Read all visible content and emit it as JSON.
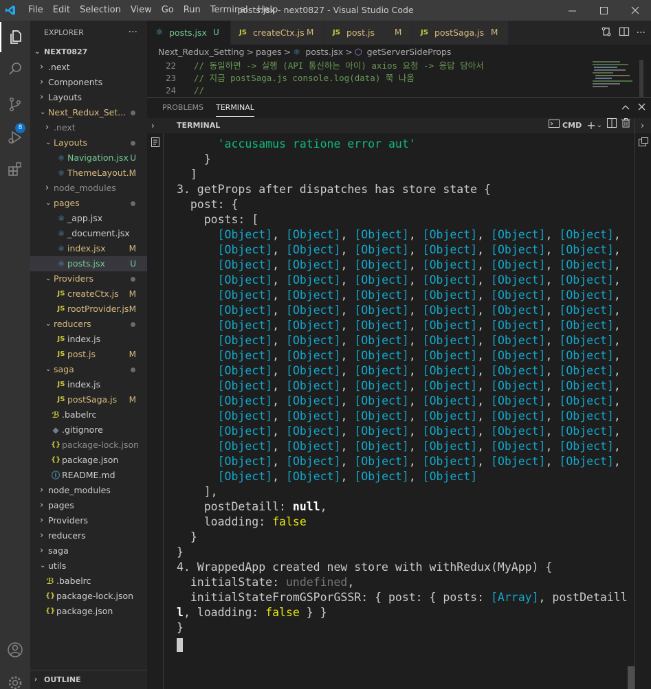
{
  "titlebar": {
    "menu": [
      "File",
      "Edit",
      "Selection",
      "View",
      "Go",
      "Run",
      "Terminal",
      "Help"
    ],
    "title": "posts.jsx - next0827 - Visual Studio Code"
  },
  "activity": {
    "scm_badge": "8"
  },
  "explorer": {
    "title": "EXPLORER",
    "more": "···",
    "root": "NEXT0827",
    "items": [
      {
        "label": ".next",
        "indent": 1,
        "kind": "folder",
        "open": false
      },
      {
        "label": "Components",
        "indent": 1,
        "kind": "folder",
        "open": false
      },
      {
        "label": "Layouts",
        "indent": 1,
        "kind": "folder",
        "open": false
      },
      {
        "label": "Next_Redux_Set...",
        "indent": 1,
        "kind": "folder",
        "open": true,
        "color": "#d7ba7d",
        "dot": true
      },
      {
        "label": ".next",
        "indent": 2,
        "kind": "folder",
        "open": false,
        "color": "#8c8c8c"
      },
      {
        "label": "Layouts",
        "indent": 2,
        "kind": "folder",
        "open": true,
        "color": "#d7ba7d",
        "dot": true
      },
      {
        "label": "Navigation.jsx",
        "indent": 3,
        "kind": "react",
        "color": "#73c991",
        "status": "U",
        "status_color": "#73c991"
      },
      {
        "label": "ThemeLayout...",
        "indent": 3,
        "kind": "react",
        "color": "#d7ba7d",
        "status": "M",
        "status_color": "#d7ba7d"
      },
      {
        "label": "node_modules",
        "indent": 2,
        "kind": "folder",
        "open": false,
        "color": "#8c8c8c"
      },
      {
        "label": "pages",
        "indent": 2,
        "kind": "folder",
        "open": true,
        "color": "#d7ba7d",
        "dot": true
      },
      {
        "label": "_app.jsx",
        "indent": 3,
        "kind": "react"
      },
      {
        "label": "_document.jsx",
        "indent": 3,
        "kind": "react"
      },
      {
        "label": "index.jsx",
        "indent": 3,
        "kind": "react",
        "color": "#d7ba7d",
        "status": "M",
        "status_color": "#d7ba7d"
      },
      {
        "label": "posts.jsx",
        "indent": 3,
        "kind": "react",
        "color": "#73c991",
        "status": "U",
        "status_color": "#73c991",
        "selected": true
      },
      {
        "label": "Providers",
        "indent": 2,
        "kind": "folder",
        "open": true,
        "color": "#d7ba7d",
        "dot": true
      },
      {
        "label": "createCtx.js",
        "indent": 3,
        "kind": "js",
        "color": "#d7ba7d",
        "status": "M",
        "status_color": "#d7ba7d"
      },
      {
        "label": "rootProvider.js",
        "indent": 3,
        "kind": "js",
        "color": "#d7ba7d",
        "status": "M",
        "status_color": "#d7ba7d"
      },
      {
        "label": "reducers",
        "indent": 2,
        "kind": "folder",
        "open": true,
        "color": "#d7ba7d",
        "dot": true
      },
      {
        "label": "index.js",
        "indent": 3,
        "kind": "js"
      },
      {
        "label": "post.js",
        "indent": 3,
        "kind": "js",
        "color": "#d7ba7d",
        "status": "M",
        "status_color": "#d7ba7d"
      },
      {
        "label": "saga",
        "indent": 2,
        "kind": "folder",
        "open": true,
        "color": "#d7ba7d",
        "dot": true
      },
      {
        "label": "index.js",
        "indent": 3,
        "kind": "js"
      },
      {
        "label": "postSaga.js",
        "indent": 3,
        "kind": "js",
        "color": "#d7ba7d",
        "status": "M",
        "status_color": "#d7ba7d"
      },
      {
        "label": ".babelrc",
        "indent": 2,
        "kind": "babel"
      },
      {
        "label": ".gitignore",
        "indent": 2,
        "kind": "git"
      },
      {
        "label": "package-lock.json",
        "indent": 2,
        "kind": "json",
        "color": "#8c8c8c"
      },
      {
        "label": "package.json",
        "indent": 2,
        "kind": "json"
      },
      {
        "label": "README.md",
        "indent": 2,
        "kind": "info"
      },
      {
        "label": "node_modules",
        "indent": 1,
        "kind": "folder",
        "open": false
      },
      {
        "label": "pages",
        "indent": 1,
        "kind": "folder",
        "open": false
      },
      {
        "label": "Providers",
        "indent": 1,
        "kind": "folder",
        "open": false
      },
      {
        "label": "reducers",
        "indent": 1,
        "kind": "folder",
        "open": false
      },
      {
        "label": "saga",
        "indent": 1,
        "kind": "folder",
        "open": false
      },
      {
        "label": "utils",
        "indent": 1,
        "kind": "folder",
        "open": true
      },
      {
        "label": ".babelrc",
        "indent": 1,
        "kind": "babel"
      },
      {
        "label": "package-lock.json",
        "indent": 1,
        "kind": "json"
      },
      {
        "label": "package.json",
        "indent": 1,
        "kind": "json"
      }
    ],
    "outline": "OUTLINE"
  },
  "tabs": [
    {
      "label": "posts.jsx",
      "kind": "react",
      "status": "U",
      "status_color": "#73c991",
      "label_color": "#73c991",
      "active": true
    },
    {
      "label": "createCtx.js",
      "kind": "js",
      "status": "M",
      "status_color": "#d7ba7d",
      "label_color": "#d7ba7d"
    },
    {
      "label": "post.js",
      "kind": "js",
      "status": "M",
      "status_color": "#d7ba7d",
      "label_color": "#d7ba7d"
    },
    {
      "label": "postSaga.js",
      "kind": "js",
      "status": "M",
      "status_color": "#d7ba7d",
      "label_color": "#d7ba7d"
    }
  ],
  "breadcrumb": [
    "Next_Redux_Setting",
    ">",
    "pages",
    ">",
    "posts.jsx",
    ">",
    "getServerSideProps"
  ],
  "code": [
    {
      "n": "22",
      "text": "// 동일하면 -> 실행 (API 통신하는 아이) axios 요청 -> 응답 담아서"
    },
    {
      "n": "23",
      "text": "// 지금 postSaga.js console.log(data) 쭉 나옴"
    },
    {
      "n": "24",
      "text": "//"
    }
  ],
  "panel": {
    "tabs": [
      "PROBLEMS",
      "TERMINAL"
    ],
    "active": "TERMINAL",
    "header": "TERMINAL",
    "shell": "CMD"
  },
  "terminal": {
    "object_token": "[Object]",
    "lines": [
      [
        {
          "t": "      "
        },
        {
          "t": "'accusamus ratione error aut'",
          "c": "gr"
        }
      ],
      [
        {
          "t": "    }"
        }
      ],
      [
        {
          "t": "  ]"
        }
      ],
      [
        {
          "t": "3. getProps after dispatches has store state {"
        }
      ],
      [
        {
          "t": "  post: {"
        }
      ],
      [
        {
          "t": "    posts: ["
        }
      ],
      {
        "objrow": 6,
        "last": false
      },
      {
        "objrow": 6,
        "last": false
      },
      {
        "objrow": 6,
        "last": false
      },
      {
        "objrow": 6,
        "last": false
      },
      {
        "objrow": 6,
        "last": false
      },
      {
        "objrow": 6,
        "last": false
      },
      {
        "objrow": 6,
        "last": false
      },
      {
        "objrow": 6,
        "last": false
      },
      {
        "objrow": 6,
        "last": false
      },
      {
        "objrow": 6,
        "last": false
      },
      {
        "objrow": 6,
        "last": false
      },
      {
        "objrow": 6,
        "last": false
      },
      {
        "objrow": 6,
        "last": false
      },
      {
        "objrow": 6,
        "last": false
      },
      {
        "objrow": 6,
        "last": false
      },
      {
        "objrow": 6,
        "last": false
      },
      {
        "objrow": 4,
        "last": true
      },
      [
        {
          "t": "    ],"
        }
      ],
      [
        {
          "t": "    postDetaill: "
        },
        {
          "t": "null",
          "c": "wb"
        },
        {
          "t": ","
        }
      ],
      [
        {
          "t": "    loadding: "
        },
        {
          "t": "false",
          "c": "ye"
        }
      ],
      [
        {
          "t": "  }"
        }
      ],
      [
        {
          "t": "}"
        }
      ],
      [
        {
          "t": "4. WrappedApp created new store with withRedux(MyApp) {"
        }
      ],
      [
        {
          "t": "  initialState: "
        },
        {
          "t": "undefined",
          "c": "gy"
        },
        {
          "t": ","
        }
      ],
      [
        {
          "t": "  initialStateFromGSPorGSSR: { post: { posts: "
        },
        {
          "t": "[Array]",
          "c": "cy"
        },
        {
          "t": ", postDetaill: "
        },
        {
          "t": "nul",
          "c": "wb"
        }
      ],
      [
        {
          "t": "l",
          "c": "wb"
        },
        {
          "t": ", loadding: "
        },
        {
          "t": "false",
          "c": "ye"
        },
        {
          "t": " } }"
        }
      ],
      [
        {
          "t": "}"
        }
      ]
    ]
  }
}
